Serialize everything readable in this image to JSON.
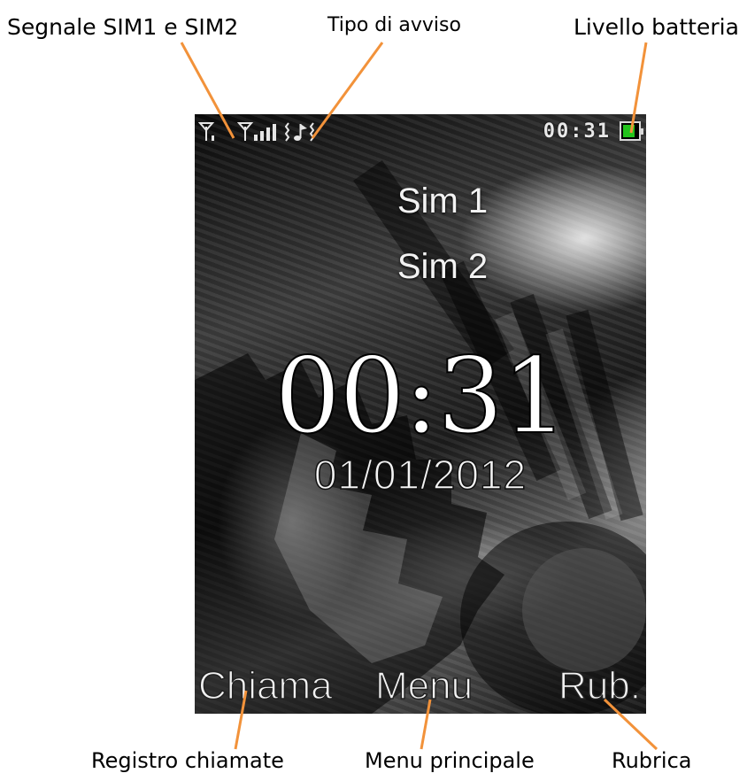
{
  "annotations": {
    "signal": "Segnale SIM1 e SIM2",
    "alert_type": "Tipo di avviso",
    "battery": "Livello batteria",
    "call_log": "Registro chiamate",
    "main_menu": "Menu principale",
    "phonebook": "Rubrica"
  },
  "status_bar": {
    "time": "00:31",
    "battery_level": 0.8,
    "battery_color": "#22c41c",
    "icons": [
      "sim1-signal-icon",
      "sim2-signal-icon",
      "alert-type-icon",
      "battery-icon"
    ]
  },
  "idle_screen": {
    "sim1": "Sim 1",
    "sim2": "Sim 2",
    "clock": "00:31",
    "date": "01/01/2012"
  },
  "softkeys": {
    "left": "Chiama",
    "center": "Menu",
    "right": "Rub."
  },
  "colors": {
    "leader_line": "#f2923a"
  }
}
